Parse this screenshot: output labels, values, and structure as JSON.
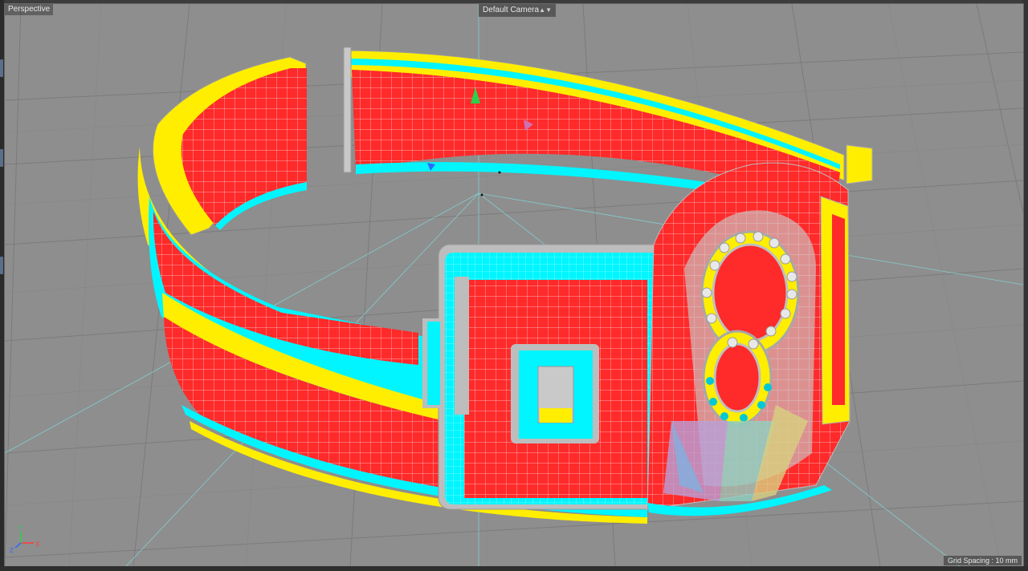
{
  "viewport": {
    "view_name": "Perspective",
    "camera": "Default Camera",
    "camera_arrows": "▲▼",
    "grid_spacing": "Grid Spacing : 10 mm"
  },
  "axis_gizmo": {
    "x": "X",
    "y": "Y",
    "z": "Z"
  },
  "colors": {
    "viewport_bg": "#8e8e8e",
    "grid_line": "#7d7d7d",
    "band_face": "#ff2a2a",
    "edge_yellow": "#ffee00",
    "edge_cyan": "#00f5ff",
    "bevel_grey": "#b8b8b8",
    "axis_x": "#ff3b3b",
    "axis_y": "#28d24a",
    "axis_z": "#2a6bff"
  },
  "icons": {
    "camera_arrows": "up-down-arrows-icon",
    "gizmo": "axis-gizmo-icon"
  }
}
